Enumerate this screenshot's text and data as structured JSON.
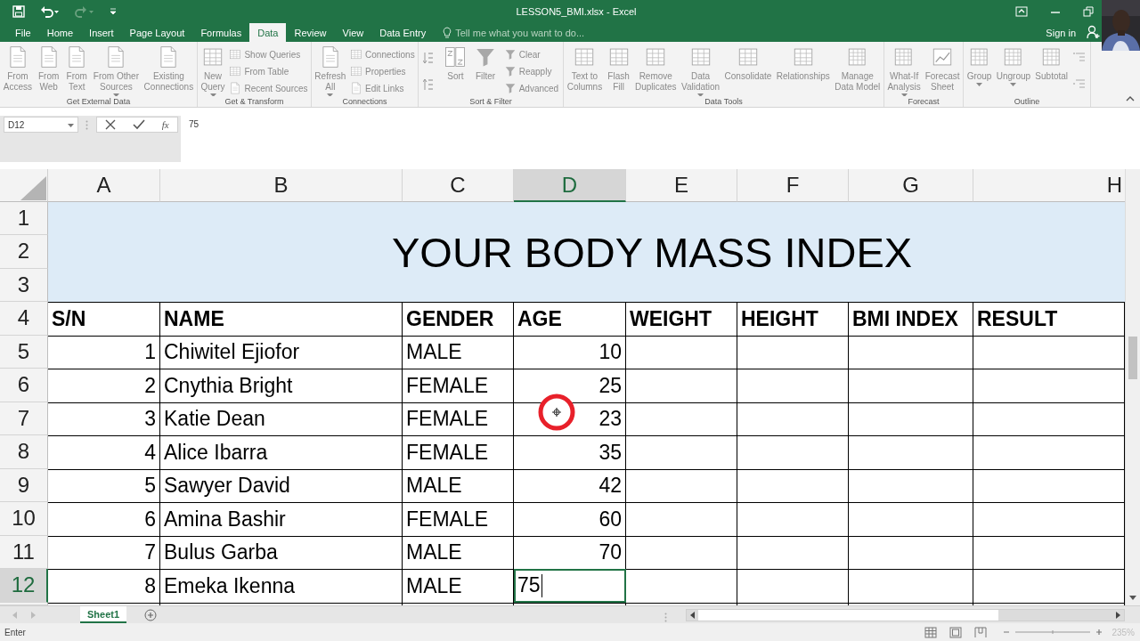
{
  "window": {
    "title": "LESSON5_BMI.xlsx - Excel"
  },
  "tabs": [
    {
      "label": "File",
      "selected": false
    },
    {
      "label": "Home",
      "selected": false
    },
    {
      "label": "Insert",
      "selected": false
    },
    {
      "label": "Page Layout",
      "selected": false
    },
    {
      "label": "Formulas",
      "selected": false
    },
    {
      "label": "Data",
      "selected": true
    },
    {
      "label": "Review",
      "selected": false
    },
    {
      "label": "View",
      "selected": false
    },
    {
      "label": "Data Entry",
      "selected": false
    }
  ],
  "tell_me": {
    "placeholder": "Tell me what you want to do..."
  },
  "account": {
    "label": "Sign in"
  },
  "ribbon": {
    "groups": [
      {
        "kind": "standard",
        "label": "Get External Data",
        "large": [
          {
            "label": "From\nAccess",
            "dropdown": false
          },
          {
            "label": "From\nWeb",
            "dropdown": false
          },
          {
            "label": "From\nText",
            "dropdown": false
          },
          {
            "label": "From Other\nSources",
            "dropdown": true
          },
          {
            "label": "Existing\nConnections",
            "dropdown": false
          }
        ]
      },
      {
        "kind": "standard",
        "label": "Get & Transform",
        "large": [
          {
            "label": "New\nQuery",
            "dropdown": true
          }
        ],
        "small": [
          "Show Queries",
          "From Table",
          "Recent Sources"
        ]
      },
      {
        "kind": "standard",
        "label": "Connections",
        "large": [
          {
            "label": "Refresh\nAll",
            "dropdown": true
          }
        ],
        "small": [
          "Connections",
          "Properties",
          "Edit Links"
        ]
      },
      {
        "kind": "sort",
        "label": "Sort & Filter",
        "large": [
          {
            "label": "Sort",
            "dropdown": false
          },
          {
            "label": "Filter",
            "dropdown": false
          }
        ],
        "small": [
          "Clear",
          "Reapply",
          "Advanced"
        ]
      },
      {
        "kind": "standard",
        "label": "Data Tools",
        "large": [
          {
            "label": "Text to\nColumns",
            "dropdown": false
          },
          {
            "label": "Flash\nFill",
            "dropdown": false
          },
          {
            "label": "Remove\nDuplicates",
            "dropdown": false
          },
          {
            "label": "Data\nValidation",
            "dropdown": true
          },
          {
            "label": "Consolidate",
            "dropdown": false
          },
          {
            "label": "Relationships",
            "dropdown": false
          },
          {
            "label": "Manage\nData Model",
            "dropdown": false
          }
        ]
      },
      {
        "kind": "standard",
        "label": "Forecast",
        "large": [
          {
            "label": "What-If\nAnalysis",
            "dropdown": true
          },
          {
            "label": "Forecast\nSheet",
            "dropdown": false
          }
        ]
      },
      {
        "kind": "outline",
        "label": "Outline",
        "large": [
          {
            "label": "Group",
            "dropdown": true
          },
          {
            "label": "Ungroup",
            "dropdown": true
          },
          {
            "label": "Subtotal",
            "dropdown": false
          }
        ]
      }
    ]
  },
  "formula_bar": {
    "name_box": "D12",
    "function_label": "fx",
    "value": "75"
  },
  "sheet": {
    "column_headers": [
      {
        "label": "A",
        "selected": false
      },
      {
        "label": "B",
        "selected": false
      },
      {
        "label": "C",
        "selected": false
      },
      {
        "label": "D",
        "selected": true
      },
      {
        "label": "E",
        "selected": false
      },
      {
        "label": "F",
        "selected": false
      },
      {
        "label": "G",
        "selected": false
      },
      {
        "label": "H",
        "selected": false
      }
    ],
    "row_headers": [
      {
        "label": "1",
        "selected": false
      },
      {
        "label": "2",
        "selected": false
      },
      {
        "label": "3",
        "selected": false
      },
      {
        "label": "4",
        "selected": false
      },
      {
        "label": "5",
        "selected": false
      },
      {
        "label": "6",
        "selected": false
      },
      {
        "label": "7",
        "selected": false
      },
      {
        "label": "8",
        "selected": false
      },
      {
        "label": "9",
        "selected": false
      },
      {
        "label": "10",
        "selected": false
      },
      {
        "label": "11",
        "selected": false
      },
      {
        "label": "12",
        "selected": true
      }
    ],
    "title": "YOUR BODY MASS INDEX",
    "table_header": [
      "S/N",
      "NAME",
      "GENDER",
      "AGE",
      "WEIGHT",
      "HEIGHT",
      "BMI INDEX",
      "RESULT"
    ],
    "rows": [
      {
        "sn": "1",
        "name": "Chiwitel Ejiofor",
        "gender": "MALE",
        "age": "10",
        "editing": false
      },
      {
        "sn": "2",
        "name": "Cnythia Bright",
        "gender": "FEMALE",
        "age": "25",
        "editing": false
      },
      {
        "sn": "3",
        "name": "Katie Dean",
        "gender": "FEMALE",
        "age": "23",
        "editing": false
      },
      {
        "sn": "4",
        "name": "Alice Ibarra",
        "gender": "FEMALE",
        "age": "35",
        "editing": false
      },
      {
        "sn": "5",
        "name": "Sawyer David",
        "gender": "MALE",
        "age": "42",
        "editing": false
      },
      {
        "sn": "6",
        "name": "Amina Bashir",
        "gender": "FEMALE",
        "age": "60",
        "editing": false
      },
      {
        "sn": "7",
        "name": "Bulus Garba",
        "gender": "MALE",
        "age": "70",
        "editing": false
      },
      {
        "sn": "8",
        "name": "Emeka Ikenna",
        "gender": "MALE",
        "age": "75",
        "editing": true
      }
    ]
  },
  "sheet_tabs": [
    {
      "label": "Sheet1",
      "selected": true
    }
  ],
  "status_bar": {
    "mode": "Enter",
    "zoom": "235%"
  }
}
